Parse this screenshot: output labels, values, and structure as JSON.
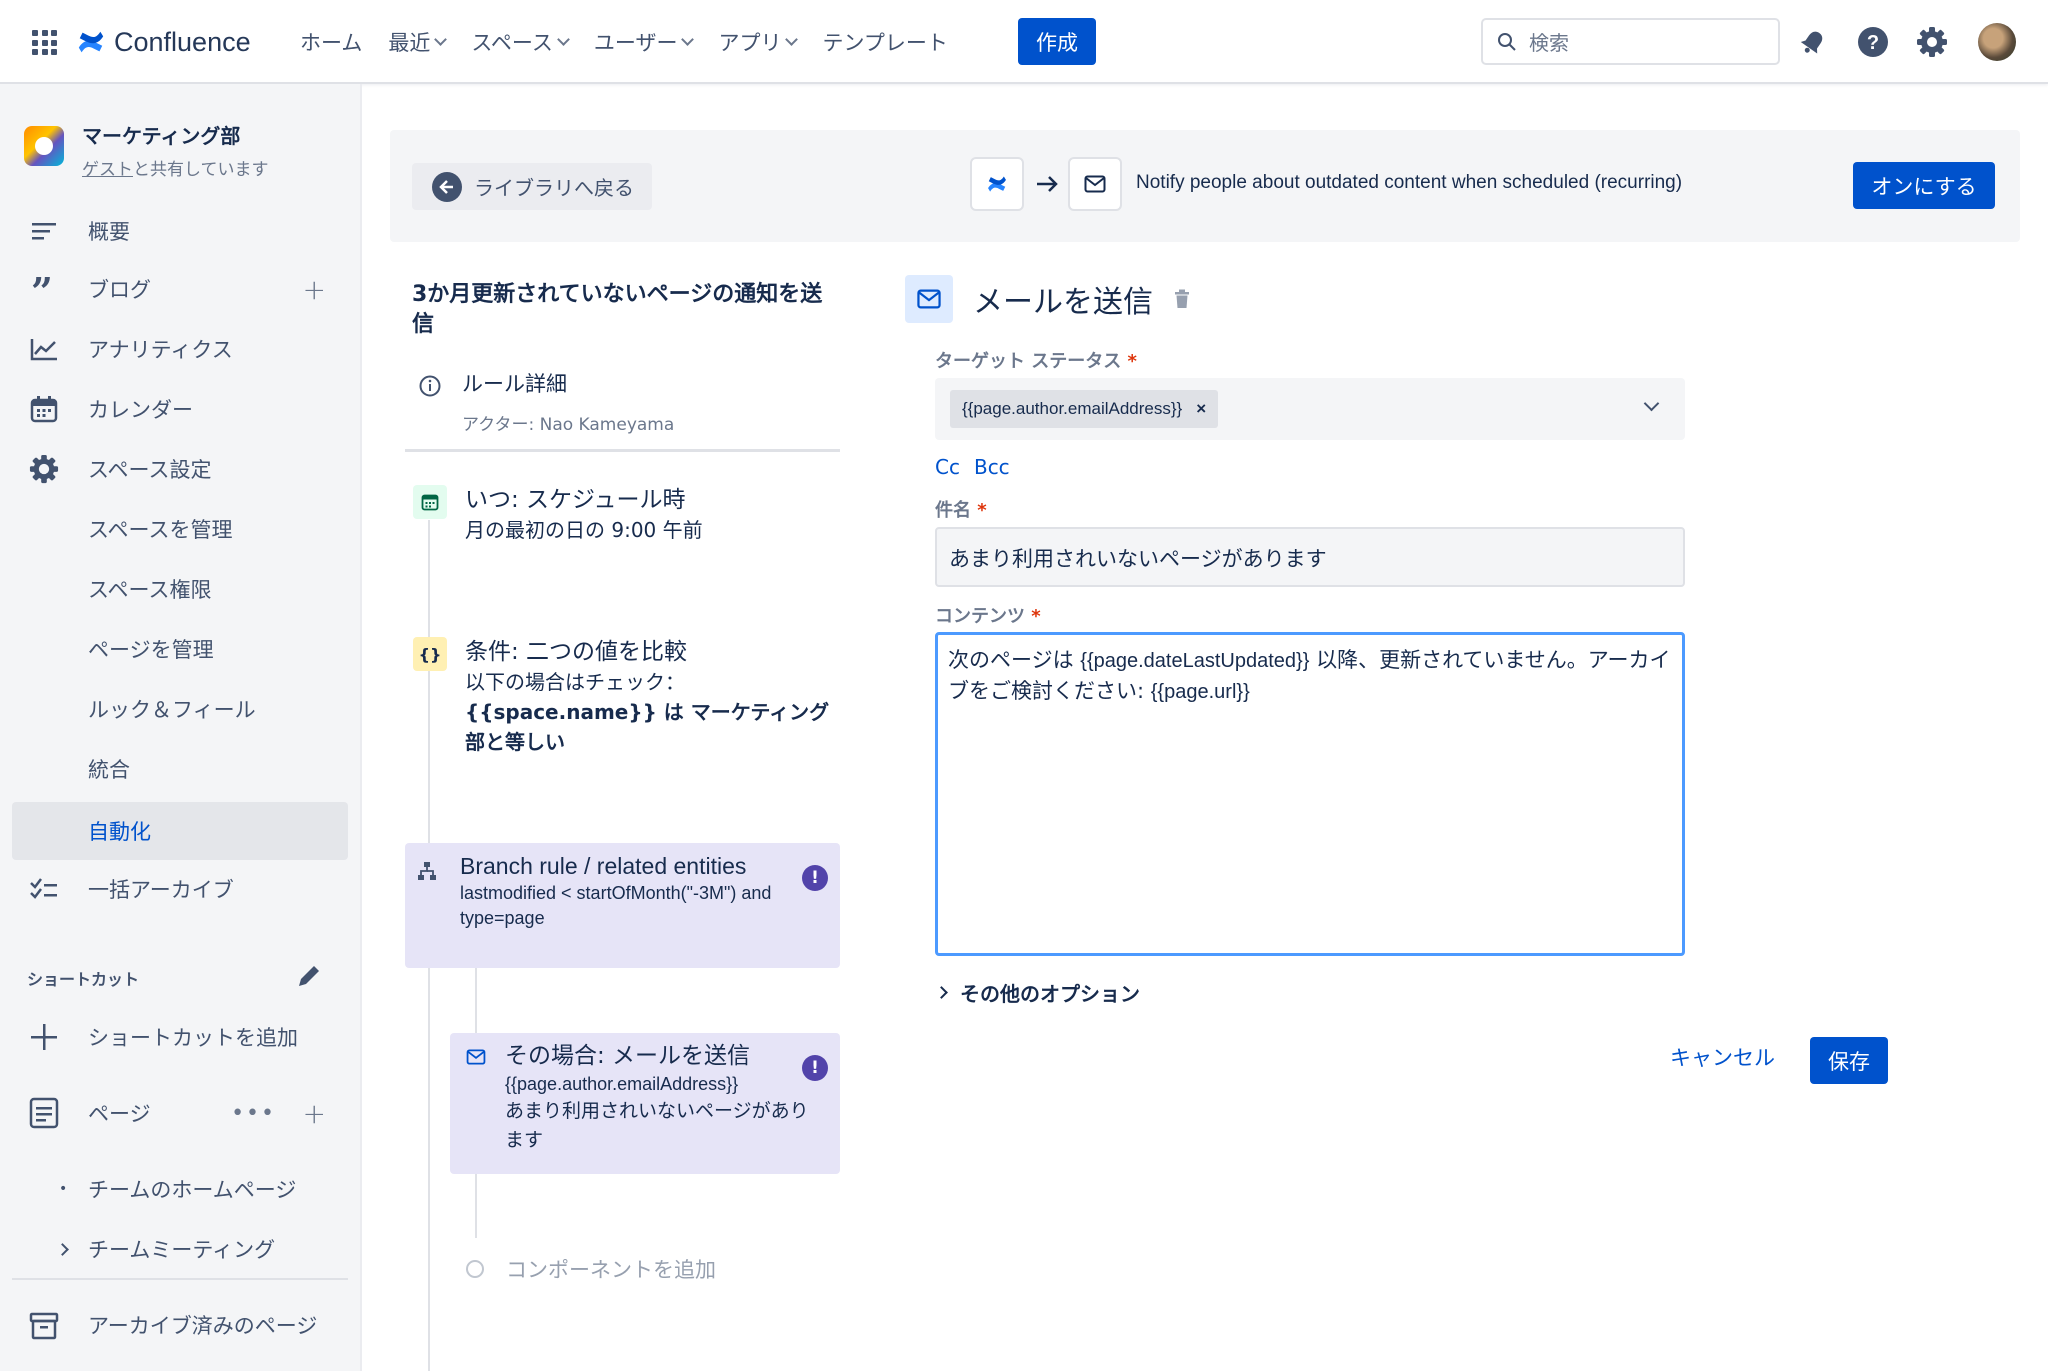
{
  "topnav": {
    "product": "Confluence",
    "items": [
      {
        "label": "ホーム",
        "dropdown": false
      },
      {
        "label": "最近",
        "dropdown": true
      },
      {
        "label": "スペース",
        "dropdown": true
      },
      {
        "label": "ユーザー",
        "dropdown": true
      },
      {
        "label": "アプリ",
        "dropdown": true
      },
      {
        "label": "テンプレート",
        "dropdown": false
      }
    ],
    "create_label": "作成",
    "search_placeholder": "検索",
    "icons": [
      "app-switcher-icon",
      "notification-icon",
      "help-icon",
      "settings-icon",
      "avatar"
    ]
  },
  "sidebar": {
    "space_name": "マーケティング部",
    "space_sub_link": "ゲスト",
    "space_sub_text": "と共有しています",
    "items": [
      {
        "label": "概要",
        "icon": "overview-icon"
      },
      {
        "label": "ブログ",
        "icon": "quote-icon"
      },
      {
        "label": "アナリティクス",
        "icon": "analytics-icon"
      },
      {
        "label": "カレンダー",
        "icon": "calendar-icon"
      },
      {
        "label": "スペース設定",
        "icon": "gear-icon"
      },
      {
        "label": "スペースを管理"
      },
      {
        "label": "スペース権限"
      },
      {
        "label": "ページを管理"
      },
      {
        "label": "ルック＆フィール"
      },
      {
        "label": "統合"
      },
      {
        "label": "自動化",
        "active": true
      },
      {
        "label": "一括アーカイブ",
        "icon": "bulk-archive-icon"
      }
    ],
    "shortcuts_heading": "ショートカット",
    "add_shortcut": "ショートカットを追加",
    "pages_label": "ページ",
    "page_tree": [
      "チームのホームページ",
      "チームミーティング"
    ],
    "archived": "アーカイブ済みのページ"
  },
  "banner": {
    "back_label": "ライブラリへ戻る",
    "flow_text": "Notify people about outdated content when scheduled (recurring)",
    "enable_label": "オンにする"
  },
  "rule": {
    "title": "3か月更新されていないページの通知を送信",
    "detail_label": "ルール詳細",
    "actor": "アクター: Nao Kameyama",
    "trigger": {
      "heading": "いつ: スケジュール時",
      "desc": "月の最初の日の 9:00 午前"
    },
    "condition": {
      "heading": "条件: 二つの値を比較",
      "desc": "以下の場合はチェック：",
      "detail": "{{space.name}} は マーケティング部と等しい"
    },
    "branch": {
      "heading": "Branch rule / related entities",
      "desc": "lastmodified < startOfMonth(\"-3M\") and type=page"
    },
    "action": {
      "heading": "その場合: メールを送信",
      "line1": "{{page.author.emailAddress}}",
      "line2": "あまり利用されいないページがあります"
    },
    "add_component": "コンポーネントを追加",
    "warn_glyph": "!"
  },
  "editor": {
    "title": "メールを送信",
    "target_label": "ターゲット ステータス",
    "target_chip": "{{page.author.emailAddress}}",
    "chip_remove": "×",
    "cc": "Cc",
    "bcc": "Bcc",
    "subject_label": "件名",
    "subject_value": "あまり利用されいないページがあります",
    "content_label": "コンテンツ",
    "content_part1": "次のページは ",
    "content_var1": "{{page.dateLastUpdated}}",
    "content_part2": " 以降、更新されていません。アーカイブをご検討ください: ",
    "content_var2": "{{page.url}}",
    "required_mark": "*",
    "more_options": "その他のオプション",
    "cancel_label": "キャンセル",
    "save_label": "保存"
  },
  "colors": {
    "brand": "#0052cc",
    "card": "#e6e4f7",
    "warn": "#5243aa",
    "focus": "#4c9aff"
  }
}
